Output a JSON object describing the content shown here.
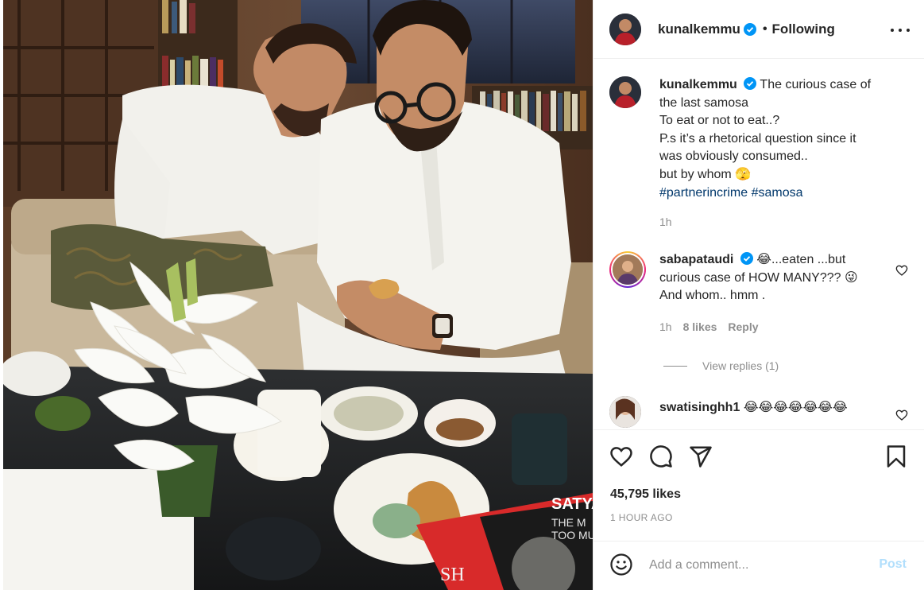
{
  "post": {
    "image_alt": "Two men in white kurtas examining a samosa at a coffee table with lilies",
    "book_title_partial": "SATYA",
    "book_sub_1": "THE M",
    "book_sub_2": "TOO MU",
    "book_spine": "SH"
  },
  "header": {
    "username": "kunalkemmu",
    "separator": "•",
    "follow_label": "Following",
    "more_icon": "more-horizontal-icon"
  },
  "caption": {
    "username": "kunalkemmu",
    "lines": [
      "The curious case of",
      "the last samosa",
      "To eat or not to eat..?",
      "P.s it’s a rhetorical question since it",
      "was obviously consumed..",
      "but by whom 🫣"
    ],
    "hashtag_1": "#partnerincrime",
    "hashtag_2": "#samosa",
    "time": "1h"
  },
  "comments": [
    {
      "username": "sabapataudi",
      "line1": "😂...eaten ...but",
      "line2": "curious case of HOW MANY??? 😜",
      "line3": "And whom.. hmm .",
      "time": "1h",
      "likes": "8 likes",
      "reply_label": "Reply",
      "view_replies": "View replies (1)"
    },
    {
      "username": "swatisinghh1",
      "text": "😂😂😂😂😂😂😂"
    }
  ],
  "actions": {
    "likes": "45,795 likes",
    "time_ago": "1 HOUR AGO"
  },
  "add_comment": {
    "placeholder": "Add a comment...",
    "post_label": "Post"
  },
  "colors": {
    "verified": "#0095f6",
    "link": "#00376b",
    "post_disabled": "#b2dffc",
    "muted": "#8e8e8e"
  }
}
